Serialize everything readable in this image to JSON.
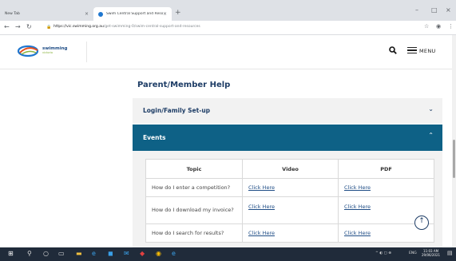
{
  "browser": {
    "tabs": [
      {
        "title": "New Tab"
      },
      {
        "title": "Swim Central Support and Reso..."
      }
    ],
    "new_tab_glyph": "+",
    "address_base": "https://vic.swimming.org.au",
    "address_rest": "/get-swimming-0/swim-central-support-and-resources"
  },
  "header": {
    "logo_text": "swimming",
    "logo_sub": "victoria",
    "menu_label": "MENU"
  },
  "page": {
    "title": "Parent/Member Help",
    "accordion": [
      {
        "label": "Login/Family Set-up",
        "expanded": false
      },
      {
        "label": "Events",
        "expanded": true
      }
    ],
    "table": {
      "headers": [
        "Topic",
        "Video",
        "PDF"
      ],
      "rows": [
        {
          "topic": "How do I enter a competition?",
          "video": "Click Here",
          "pdf": "Click Here"
        },
        {
          "topic": "How do I download my invoice?",
          "video": "Click Here",
          "pdf": "Click Here"
        },
        {
          "topic": "How do I search for results?",
          "video": "Click Here",
          "pdf": "Click Here"
        }
      ]
    }
  },
  "taskbar": {
    "lang": "ENG",
    "time": "11:03 AM",
    "date": "29/06/2021"
  },
  "colors": {
    "accent": "#0e6186",
    "heading": "#1e3d66"
  }
}
